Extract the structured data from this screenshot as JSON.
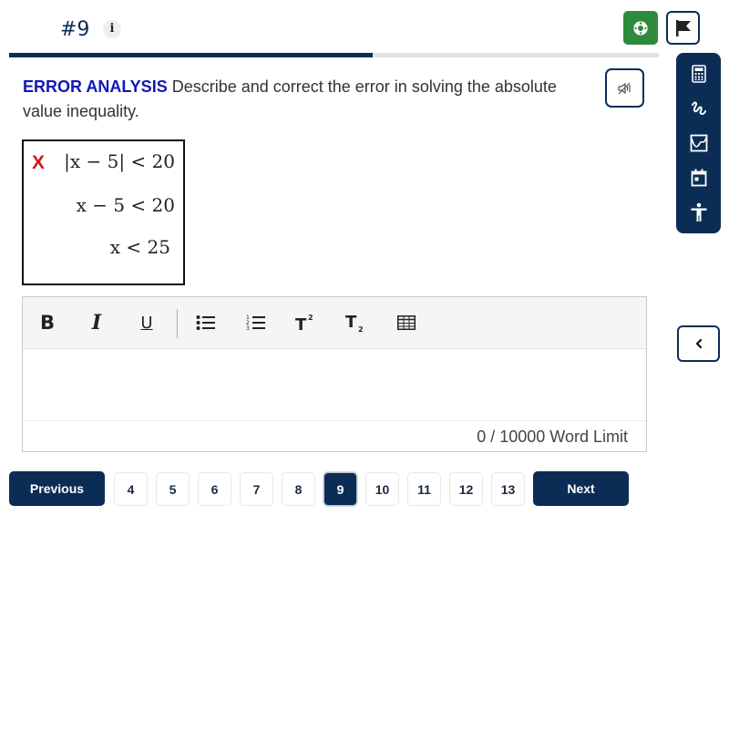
{
  "header": {
    "question_number": "#9",
    "info_label": "i",
    "progress_percent": 56
  },
  "question": {
    "keyword": "ERROR ANALYSIS",
    "prompt": " Describe and correct the error in solving the absolute value inequality."
  },
  "student_work": {
    "mark": "X",
    "mark_color": "#d21a1a",
    "lines": [
      "|x − 5| < 20",
      "x − 5 < 20",
      "x < 25"
    ]
  },
  "editor": {
    "tools": [
      "bold",
      "italic",
      "underline",
      "bulleted-list",
      "numbered-list",
      "superscript",
      "subscript",
      "table"
    ],
    "bold_label": "B",
    "italic_label": "I",
    "underline_label": "U",
    "content": "",
    "word_count": "0 / 10000 Word Limit"
  },
  "side_tools": [
    "calculator",
    "scratchpad",
    "graph",
    "calendar",
    "accessibility"
  ],
  "pagination": {
    "previous_label": "Previous",
    "next_label": "Next",
    "pages": [
      "4",
      "5",
      "6",
      "7",
      "8",
      "9",
      "10",
      "11",
      "12",
      "13"
    ],
    "current_page": "9"
  },
  "colors": {
    "primary": "#0b2d55",
    "help_green": "#2e8b3e",
    "keyword_blue": "#1017b5"
  }
}
